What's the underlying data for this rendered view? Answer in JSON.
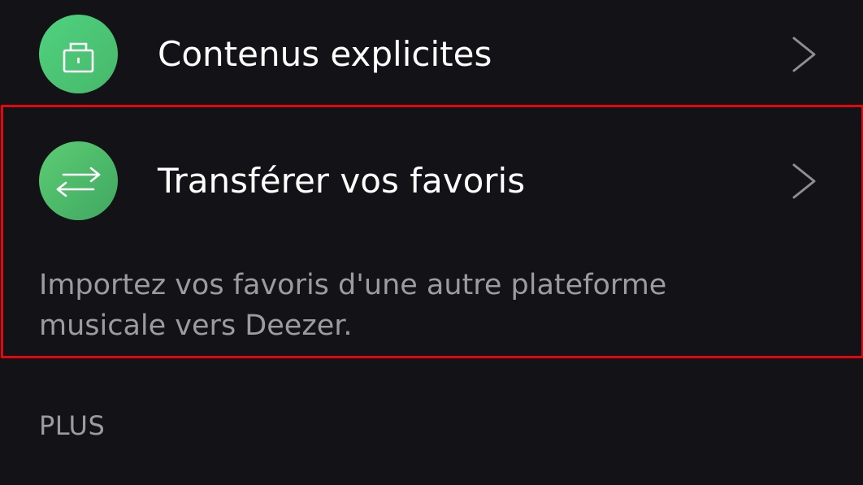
{
  "settings": {
    "explicit_content": {
      "label": "Contenus explicites",
      "icon": "lock-icon",
      "icon_color": "#4cc97b"
    },
    "transfer_favorites": {
      "label": "Transférer vos favoris",
      "icon": "swap-arrows-icon",
      "icon_color": "#4fbd6c",
      "description_lines": [
        "Importez vos favoris d'une autre plateforme",
        "musicale vers Deezer."
      ]
    },
    "section_more": {
      "title": "PLUS"
    }
  },
  "colors": {
    "background": "#131217",
    "highlight": "#e3060f",
    "secondary_text": "#9c9ba2",
    "chevron": "#8e8d93"
  }
}
